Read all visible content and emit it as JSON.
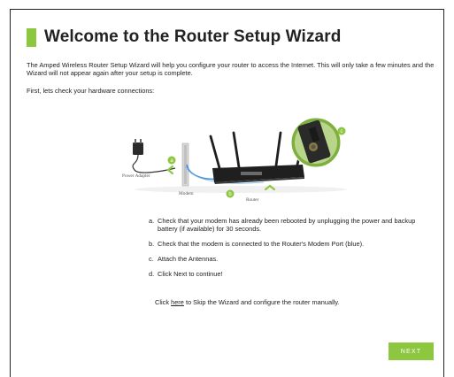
{
  "page": {
    "title": "Welcome to the Router Setup Wizard",
    "intro": "The Amped Wireless Router Setup Wizard will help you configure your router to access the Internet. This will only take a few minutes and the Wizard will not appear again after your setup is complete.",
    "first_check": "First, lets check your hardware connections:"
  },
  "illustration": {
    "labels": {
      "power_adapter": "Power Adapter",
      "modem": "Modem",
      "router": "Router"
    },
    "callouts": [
      "a",
      "b",
      "c"
    ],
    "colors": {
      "accent": "#8dc63f",
      "cable": "#4a90d9"
    }
  },
  "steps": [
    {
      "letter": "a.",
      "text": "Check that your modem has already been rebooted by unplugging the power and backup battery (if available) for 30 seconds."
    },
    {
      "letter": "b.",
      "text": "Check that the modem is connected to the Router's Modem Port (blue)."
    },
    {
      "letter": "c.",
      "text": "Attach the Antennas."
    },
    {
      "letter": "d.",
      "text": "Click Next to continue!"
    }
  ],
  "skip": {
    "prefix": "Click",
    "link": "here",
    "suffix": "to Skip the Wizard and configure the router manually."
  },
  "buttons": {
    "next": "NEXT"
  }
}
